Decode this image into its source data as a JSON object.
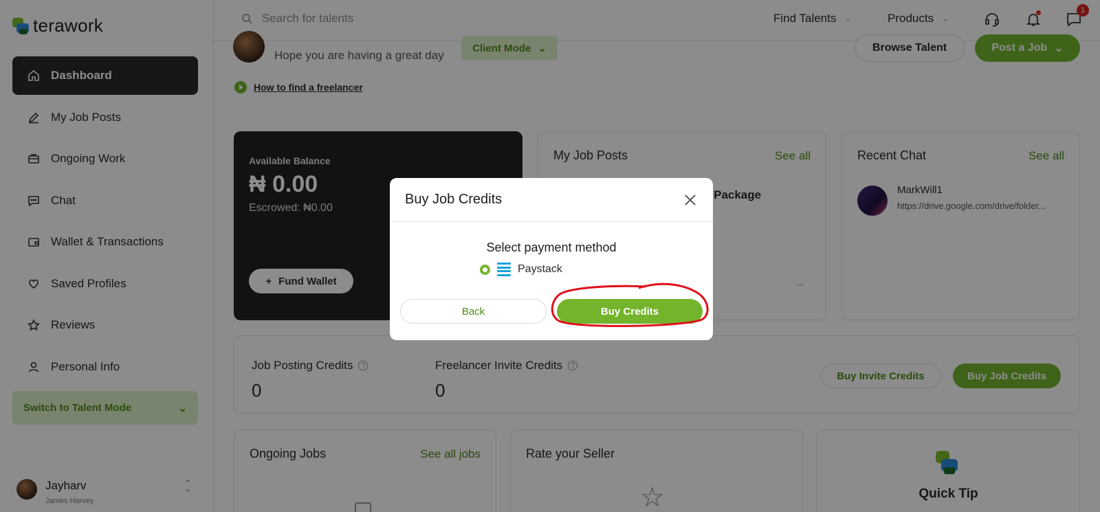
{
  "brand": {
    "name": "terawork"
  },
  "sidebar": {
    "items": [
      {
        "label": "Dashboard",
        "icon": "home-icon",
        "active": true
      },
      {
        "label": "My Job Posts",
        "icon": "pencil-icon"
      },
      {
        "label": "Ongoing Work",
        "icon": "briefcase-icon"
      },
      {
        "label": "Chat",
        "icon": "chat-icon"
      },
      {
        "label": "Wallet & Transactions",
        "icon": "wallet-icon"
      },
      {
        "label": "Saved Profiles",
        "icon": "heart-icon"
      },
      {
        "label": "Reviews",
        "icon": "star-icon"
      },
      {
        "label": "Personal Info",
        "icon": "person-icon"
      }
    ],
    "switch_mode": "Switch to Talent Mode",
    "user": {
      "name": "Jayharv",
      "full_name": "James Harvey"
    }
  },
  "topbar": {
    "search_placeholder": "Search for talents",
    "find_talents": "Find Talents",
    "products": "Products",
    "message_badge": "1"
  },
  "main": {
    "greeting_sub": "Hope you are having a great day",
    "client_mode": "Client Mode",
    "browse_talent": "Browse Talent",
    "post_job": "Post a Job",
    "how_to": "How to find a freelancer",
    "balance": {
      "label": "Available Balance",
      "amount": "₦ 0.00",
      "escrowed": "Escrowed: ₦0.00",
      "fund_button": "Fund Wallet"
    },
    "job_posts": {
      "title": "My Job Posts",
      "see_all": "See all",
      "package_text": "g Package"
    },
    "recent_chat": {
      "title": "Recent Chat",
      "see_all": "See all",
      "name": "MarkWill1",
      "message": "https://drive.google.com/drive/folder..."
    },
    "credits": {
      "job_posting_label": "Job Posting Credits",
      "job_posting_value": "0",
      "invite_label": "Freelancer Invite Credits",
      "invite_value": "0",
      "buy_invite": "Buy Invite Credits",
      "buy_job": "Buy Job Credits"
    },
    "ongoing": {
      "title": "Ongoing Jobs",
      "see_all": "See all jobs"
    },
    "rate": {
      "title": "Rate your Seller"
    },
    "tip": {
      "title": "Quick Tip"
    }
  },
  "modal": {
    "title": "Buy Job Credits",
    "subtitle": "Select payment method",
    "option": "Paystack",
    "back": "Back",
    "buy": "Buy Credits"
  },
  "colors": {
    "accent": "#74b42c",
    "dark_card": "#1f2123",
    "annotation": "#e0101a"
  }
}
